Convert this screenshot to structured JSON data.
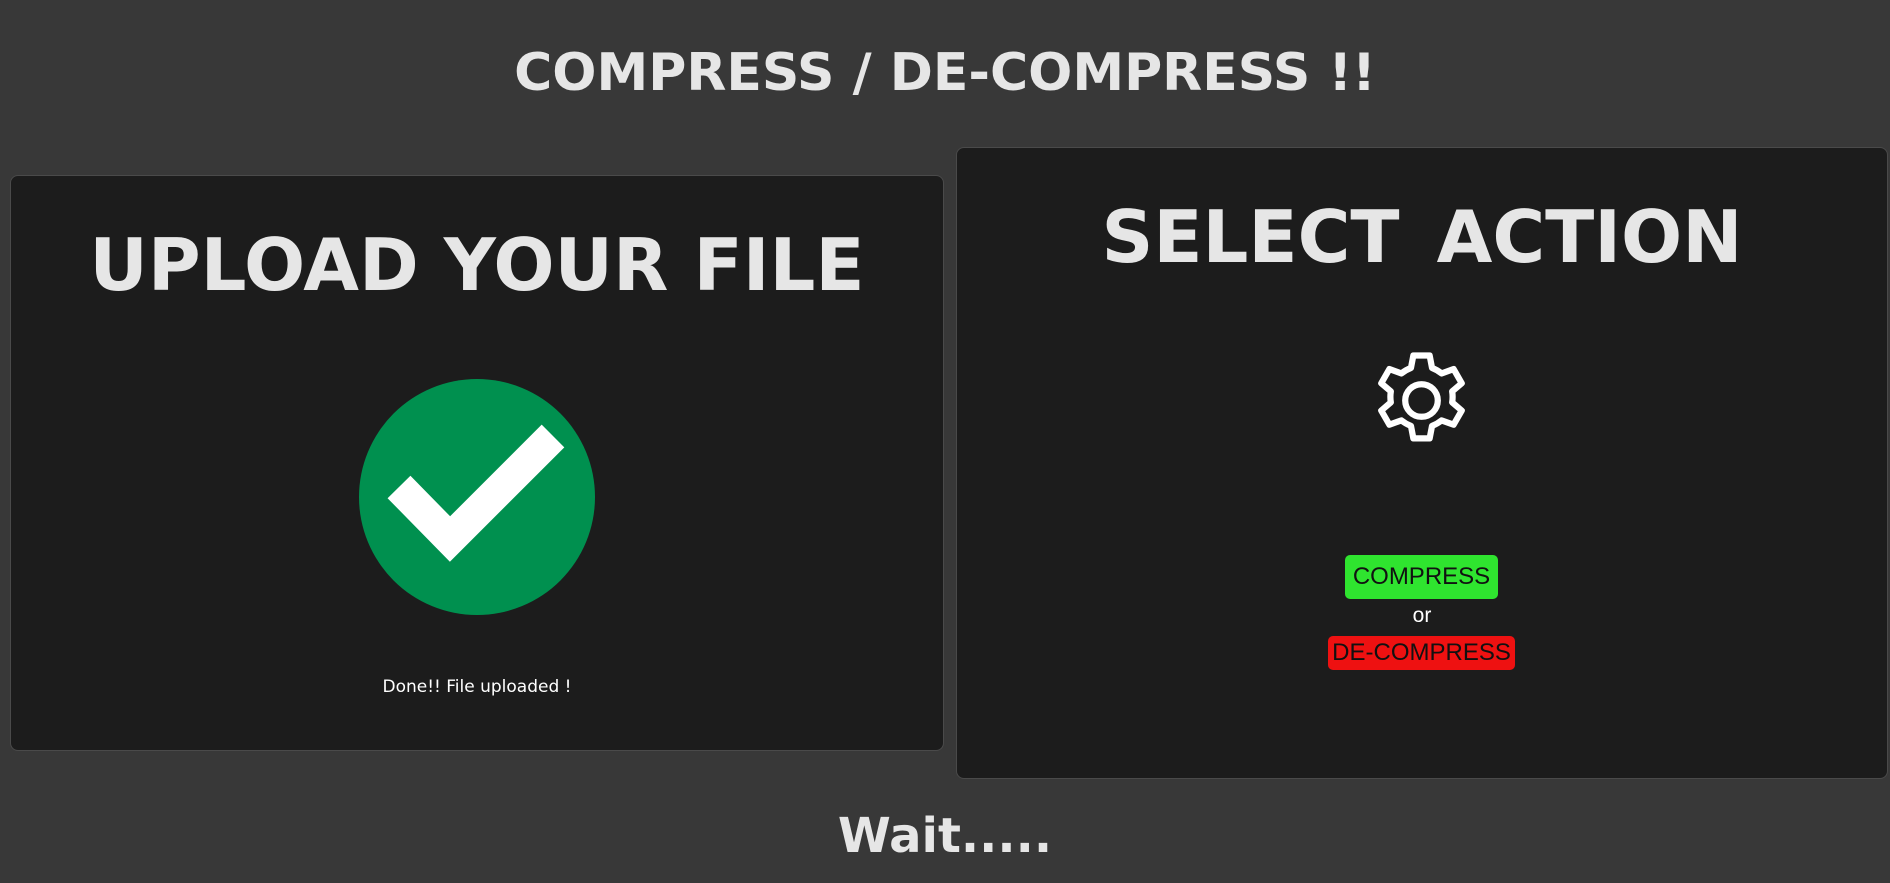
{
  "header": {
    "title": "COMPRESS / DE-COMPRESS !!"
  },
  "upload_panel": {
    "heading": "UPLOAD YOUR FILE",
    "icon": "check-circle-icon",
    "icon_color": "#00904f",
    "status": "Done!! File uploaded !"
  },
  "action_panel": {
    "heading": "SELECT  ACTION",
    "icon": "gear-icon",
    "compress_label": "COMPRESS",
    "compress_color": "#2fe42f",
    "separator": "or",
    "decompress_label": "DE-COMPRESS",
    "decompress_color": "#ee1111"
  },
  "footer": {
    "status": "Wait....."
  }
}
